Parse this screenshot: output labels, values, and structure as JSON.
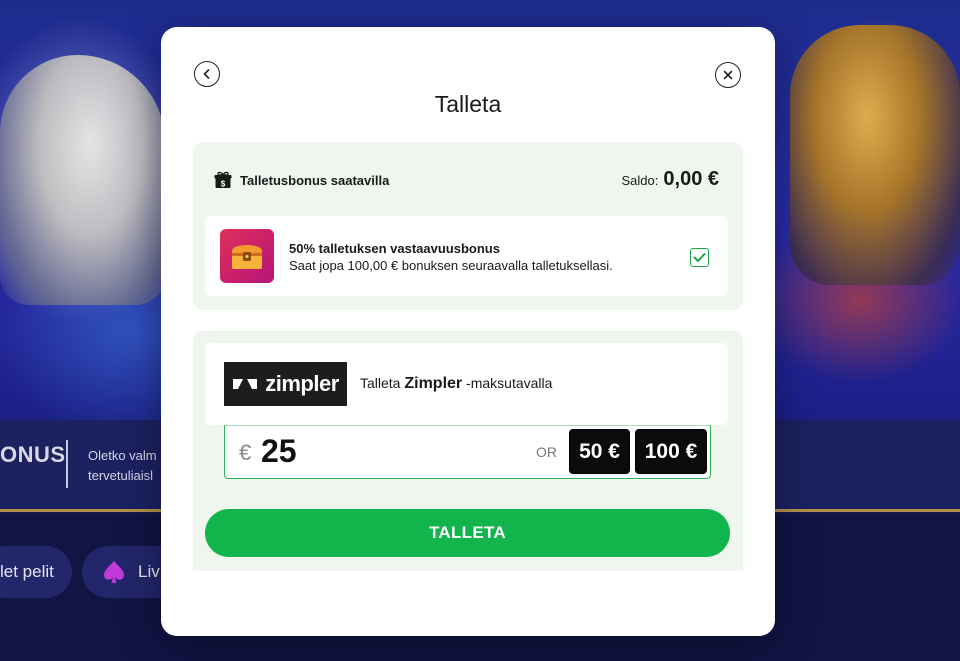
{
  "background": {
    "promo": {
      "title": "ONUS",
      "text_line1": "Oletko valm",
      "text_line2": "tervetuliaisl"
    },
    "nav": {
      "pill1": "let pelit",
      "pill2": "Liv"
    }
  },
  "modal": {
    "title": "Talleta",
    "bonus": {
      "header": "Talletusbonus saatavilla",
      "balance_label": "Saldo:",
      "balance_value": "0,00 €",
      "offer_title": "50% talletuksen vastaavuusbonus",
      "offer_desc": "Saat jopa 100,00 € bonuksen seuraavalla talletuksellasi.",
      "selected": true
    },
    "payment": {
      "logo_text": "zimpler",
      "prefix": "Talleta",
      "method": "Zimpler",
      "suffix": "-maksutavalla"
    },
    "amount": {
      "currency": "€",
      "value": "25",
      "or_label": "OR",
      "quick_options": [
        "50 €",
        "100 €"
      ]
    },
    "submit_label": "TALLETA"
  },
  "colors": {
    "accent_green": "#12b44c",
    "panel_bg": "#eef6ee",
    "modal_bg": "#ffffff",
    "page_bg": "#15174a"
  }
}
